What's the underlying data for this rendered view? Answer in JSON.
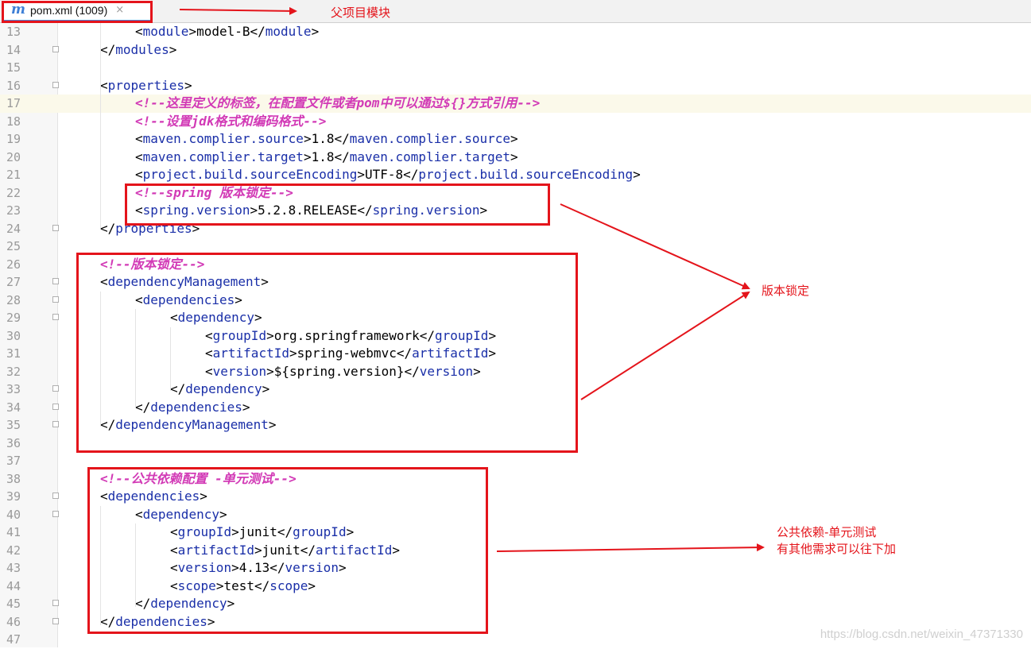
{
  "tab": {
    "icon": "maven-m-icon",
    "icon_glyph": "m",
    "title": "pom.xml (1009)",
    "close_glyph": "×"
  },
  "lines": [
    {
      "num": "13",
      "indent": 2,
      "parts": [
        [
          "t",
          "<"
        ],
        [
          "g",
          "module"
        ],
        [
          "t",
          ">model-B</"
        ],
        [
          "g",
          "module"
        ],
        [
          "t",
          ">"
        ]
      ]
    },
    {
      "num": "14",
      "indent": 1,
      "fold": true,
      "parts": [
        [
          "t",
          "</"
        ],
        [
          "g",
          "modules"
        ],
        [
          "t",
          ">"
        ]
      ]
    },
    {
      "num": "15",
      "indent": 0,
      "parts": []
    },
    {
      "num": "16",
      "indent": 1,
      "fold": true,
      "parts": [
        [
          "t",
          "<"
        ],
        [
          "g",
          "properties"
        ],
        [
          "t",
          ">"
        ]
      ]
    },
    {
      "num": "17",
      "indent": 2,
      "hl": true,
      "parts": [
        [
          "c",
          "<!--这里定义的标签，在配置文件或者pom中可以通过${}方式引用-->"
        ]
      ]
    },
    {
      "num": "18",
      "indent": 2,
      "parts": [
        [
          "c",
          "<!--设置jdk格式和编码格式-->"
        ]
      ]
    },
    {
      "num": "19",
      "indent": 2,
      "parts": [
        [
          "t",
          "<"
        ],
        [
          "g",
          "maven.complier.source"
        ],
        [
          "t",
          ">1.8</"
        ],
        [
          "g",
          "maven.complier.source"
        ],
        [
          "t",
          ">"
        ]
      ]
    },
    {
      "num": "20",
      "indent": 2,
      "parts": [
        [
          "t",
          "<"
        ],
        [
          "g",
          "maven.complier.target"
        ],
        [
          "t",
          ">1.8</"
        ],
        [
          "g",
          "maven.complier.target"
        ],
        [
          "t",
          ">"
        ]
      ]
    },
    {
      "num": "21",
      "indent": 2,
      "parts": [
        [
          "t",
          "<"
        ],
        [
          "g",
          "project.build.sourceEncoding"
        ],
        [
          "t",
          ">UTF-8</"
        ],
        [
          "g",
          "project.build.sourceEncoding"
        ],
        [
          "t",
          ">"
        ]
      ]
    },
    {
      "num": "22",
      "indent": 2,
      "parts": [
        [
          "c",
          "<!--spring 版本锁定-->"
        ]
      ]
    },
    {
      "num": "23",
      "indent": 2,
      "parts": [
        [
          "t",
          "<"
        ],
        [
          "g",
          "spring.version"
        ],
        [
          "t",
          ">5.2.8.RELEASE</"
        ],
        [
          "g",
          "spring.version"
        ],
        [
          "t",
          ">"
        ]
      ]
    },
    {
      "num": "24",
      "indent": 1,
      "fold": true,
      "parts": [
        [
          "t",
          "</"
        ],
        [
          "g",
          "properties"
        ],
        [
          "t",
          ">"
        ]
      ]
    },
    {
      "num": "25",
      "indent": 0,
      "parts": []
    },
    {
      "num": "26",
      "indent": 1,
      "parts": [
        [
          "c",
          "<!--版本锁定-->"
        ]
      ]
    },
    {
      "num": "27",
      "indent": 1,
      "fold": true,
      "parts": [
        [
          "t",
          "<"
        ],
        [
          "g",
          "dependencyManagement"
        ],
        [
          "t",
          ">"
        ]
      ]
    },
    {
      "num": "28",
      "indent": 2,
      "fold": true,
      "parts": [
        [
          "t",
          "<"
        ],
        [
          "g",
          "dependencies"
        ],
        [
          "t",
          ">"
        ]
      ]
    },
    {
      "num": "29",
      "indent": 3,
      "fold": true,
      "parts": [
        [
          "t",
          "<"
        ],
        [
          "g",
          "dependency"
        ],
        [
          "t",
          ">"
        ]
      ]
    },
    {
      "num": "30",
      "indent": 4,
      "parts": [
        [
          "t",
          "<"
        ],
        [
          "g",
          "groupId"
        ],
        [
          "t",
          ">org.springframework</"
        ],
        [
          "g",
          "groupId"
        ],
        [
          "t",
          ">"
        ]
      ]
    },
    {
      "num": "31",
      "indent": 4,
      "parts": [
        [
          "t",
          "<"
        ],
        [
          "g",
          "artifactId"
        ],
        [
          "t",
          ">spring-webmvc</"
        ],
        [
          "g",
          "artifactId"
        ],
        [
          "t",
          ">"
        ]
      ]
    },
    {
      "num": "32",
      "indent": 4,
      "parts": [
        [
          "t",
          "<"
        ],
        [
          "g",
          "version"
        ],
        [
          "t",
          ">${spring.version}</"
        ],
        [
          "g",
          "version"
        ],
        [
          "t",
          ">"
        ]
      ]
    },
    {
      "num": "33",
      "indent": 3,
      "fold": true,
      "parts": [
        [
          "t",
          "</"
        ],
        [
          "g",
          "dependency"
        ],
        [
          "t",
          ">"
        ]
      ]
    },
    {
      "num": "34",
      "indent": 2,
      "fold": true,
      "parts": [
        [
          "t",
          "</"
        ],
        [
          "g",
          "dependencies"
        ],
        [
          "t",
          ">"
        ]
      ]
    },
    {
      "num": "35",
      "indent": 1,
      "fold": true,
      "parts": [
        [
          "t",
          "</"
        ],
        [
          "g",
          "dependencyManagement"
        ],
        [
          "t",
          ">"
        ]
      ]
    },
    {
      "num": "36",
      "indent": 0,
      "parts": []
    },
    {
      "num": "37",
      "indent": 0,
      "parts": []
    },
    {
      "num": "38",
      "indent": 1,
      "parts": [
        [
          "c",
          "<!--公共依赖配置 -单元测试-->"
        ]
      ]
    },
    {
      "num": "39",
      "indent": 1,
      "fold": true,
      "parts": [
        [
          "t",
          "<"
        ],
        [
          "g",
          "dependencies"
        ],
        [
          "t",
          ">"
        ]
      ]
    },
    {
      "num": "40",
      "indent": 2,
      "fold": true,
      "parts": [
        [
          "t",
          "<"
        ],
        [
          "g",
          "dependency"
        ],
        [
          "t",
          ">"
        ]
      ]
    },
    {
      "num": "41",
      "indent": 3,
      "parts": [
        [
          "t",
          "<"
        ],
        [
          "g",
          "groupId"
        ],
        [
          "t",
          ">junit</"
        ],
        [
          "g",
          "groupId"
        ],
        [
          "t",
          ">"
        ]
      ]
    },
    {
      "num": "42",
      "indent": 3,
      "parts": [
        [
          "t",
          "<"
        ],
        [
          "g",
          "artifactId"
        ],
        [
          "t",
          ">junit</"
        ],
        [
          "g",
          "artifactId"
        ],
        [
          "t",
          ">"
        ]
      ]
    },
    {
      "num": "43",
      "indent": 3,
      "parts": [
        [
          "t",
          "<"
        ],
        [
          "g",
          "version"
        ],
        [
          "t",
          ">4.13</"
        ],
        [
          "g",
          "version"
        ],
        [
          "t",
          ">"
        ]
      ]
    },
    {
      "num": "44",
      "indent": 3,
      "parts": [
        [
          "t",
          "<"
        ],
        [
          "g",
          "scope"
        ],
        [
          "t",
          ">test</"
        ],
        [
          "g",
          "scope"
        ],
        [
          "t",
          ">"
        ]
      ]
    },
    {
      "num": "45",
      "indent": 2,
      "fold": true,
      "parts": [
        [
          "t",
          "</"
        ],
        [
          "g",
          "dependency"
        ],
        [
          "t",
          ">"
        ]
      ]
    },
    {
      "num": "46",
      "indent": 1,
      "fold": true,
      "parts": [
        [
          "t",
          "</"
        ],
        [
          "g",
          "dependencies"
        ],
        [
          "t",
          ">"
        ]
      ]
    },
    {
      "num": "47",
      "indent": 0,
      "parts": []
    }
  ],
  "annotations": {
    "parent_module": "父项目模块",
    "version_lock": "版本锁定",
    "common_deps_line1": "公共依赖-单元测试",
    "common_deps_line2": "有其他需求可以往下加"
  },
  "watermark": "https://blog.csdn.net/weixin_47371330",
  "colors": {
    "tag": "#1a2fa8",
    "comment": "#d23ab6",
    "annotation": "#e4141b",
    "tab_underline": "#4a89dc"
  }
}
